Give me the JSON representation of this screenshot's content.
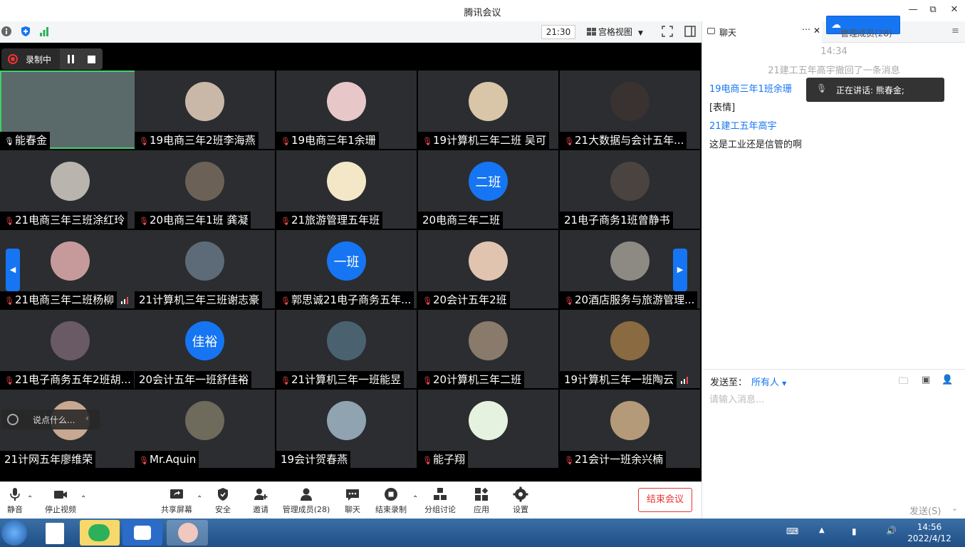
{
  "window": {
    "title": "腾讯会议",
    "min": "—",
    "max": "⧉",
    "close": "✕"
  },
  "toolbar": {
    "time": "21:30",
    "view_label": "宫格视图"
  },
  "recording": {
    "label": "录制中"
  },
  "tiles": [
    {
      "name": "能春金",
      "avatar_text": "",
      "color": "#5a6a6a",
      "mic": "on"
    },
    {
      "name": "19电商三年2班李海燕",
      "avatar_text": "",
      "color": "#c9b8a8",
      "mic": "muted"
    },
    {
      "name": "19电商三年1余珊",
      "avatar_text": "",
      "color": "#e8c7c8",
      "mic": "muted"
    },
    {
      "name": "19计算机三年二班 吴可",
      "avatar_text": "",
      "color": "#d9c6a8",
      "mic": "muted"
    },
    {
      "name": "21大数据与会计五年...",
      "avatar_text": "",
      "color": "#3a3230",
      "mic": "muted"
    },
    {
      "name": "21电商三年三班涂红玲",
      "avatar_text": "",
      "color": "#b9b4ad",
      "mic": "muted"
    },
    {
      "name": "20电商三年1班 龚凝",
      "avatar_text": "",
      "color": "#6b6156",
      "mic": "muted"
    },
    {
      "name": "21旅游管理五年班",
      "avatar_text": "",
      "color": "#f3e7c8",
      "mic": "muted"
    },
    {
      "name": "20电商三年二班",
      "avatar_text": "二班",
      "color": "#1675f2",
      "mic": "none"
    },
    {
      "name": "21电子商务1班曾静书",
      "avatar_text": "",
      "color": "#4a4340",
      "mic": "none"
    },
    {
      "name": "21电商三年二班杨柳",
      "avatar_text": "",
      "color": "#c69a9a",
      "mic": "muted",
      "signal": true
    },
    {
      "name": "21计算机三年三班谢志豪",
      "avatar_text": "",
      "color": "#5d6b78",
      "mic": "none"
    },
    {
      "name": "郭思诚21电子商务五年...",
      "avatar_text": "一班",
      "color": "#1675f2",
      "mic": "muted"
    },
    {
      "name": "20会计五年2班",
      "avatar_text": "",
      "color": "#e0c4b0",
      "mic": "muted"
    },
    {
      "name": "20酒店服务与旅游管理...",
      "avatar_text": "",
      "color": "#8c8a82",
      "mic": "muted"
    },
    {
      "name": "21电子商务五年2班胡...",
      "avatar_text": "",
      "color": "#6a5a66",
      "mic": "muted"
    },
    {
      "name": "20会计五年一班舒佳裕",
      "avatar_text": "佳裕",
      "color": "#1675f2",
      "mic": "none"
    },
    {
      "name": "21计算机三年一班能昱",
      "avatar_text": "",
      "color": "#4a6270",
      "mic": "muted"
    },
    {
      "name": "20计算机三年二班",
      "avatar_text": "",
      "color": "#8a7a6c",
      "mic": "muted"
    },
    {
      "name": "19计算机三年一班陶云",
      "avatar_text": "",
      "color": "#8a6a40",
      "mic": "none",
      "signal": true
    },
    {
      "name": "21计网五年廖维荣",
      "avatar_text": "",
      "color": "#c8a890",
      "mic": "none"
    },
    {
      "name": "Mr.Aquin",
      "avatar_text": "",
      "color": "#6e6a5c",
      "mic": "muted"
    },
    {
      "name": "19会计贺春燕",
      "avatar_text": "",
      "color": "#8fa3b0",
      "mic": "none"
    },
    {
      "name": "能子翔",
      "avatar_text": "",
      "color": "#e6f2e0",
      "mic": "muted"
    },
    {
      "name": "21会计一班余兴楠",
      "avatar_text": "",
      "color": "#b49a78",
      "mic": "muted"
    }
  ],
  "overlay": {
    "say_something": "说点什么..."
  },
  "bottombar": {
    "mute": "静音",
    "stop_video": "停止视频",
    "share": "共享屏幕",
    "security": "安全",
    "invite": "邀请",
    "members": "管理成员(28)",
    "chat": "聊天",
    "end_record": "结束录制",
    "breakout": "分组讨论",
    "apps": "应用",
    "settings": "设置",
    "end_meeting": "结束会议"
  },
  "chat": {
    "tab_label": "聊天",
    "members_tab": "管理成员(28)",
    "time": "14:34",
    "recall_notice": "21建工五年高宇撤回了一条消息",
    "msg1_sender": "19电商三年1班余珊",
    "msg1_text": "[表情]",
    "msg2_sender": "21建工五年高宇",
    "msg2_text": "这是工业还是信管的啊",
    "speaking_label": "正在讲话: 熊春金;",
    "send_to_label": "发送至：",
    "send_to_value": "所有人",
    "input_placeholder": "请输入消息...",
    "send_button": "发送(S)"
  },
  "taskbar": {
    "time": "14:56",
    "date": "2022/4/12"
  }
}
